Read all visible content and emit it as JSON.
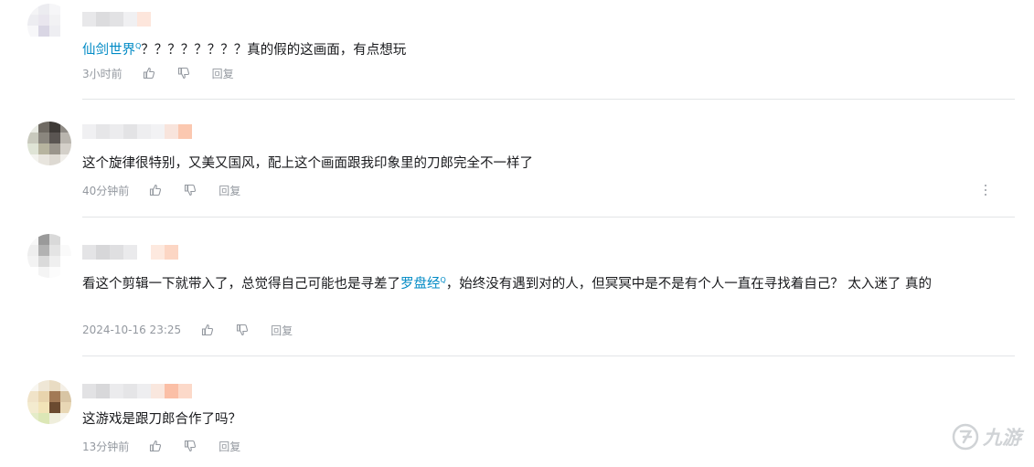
{
  "comments": [
    {
      "link_text": "仙剑世界",
      "link_mark": "Q",
      "text": "？？？？？？？？真的假的这画面，有点想玩",
      "time": "3小时前",
      "reply_label": "回复"
    },
    {
      "text": "这个旋律很特别，又美又国风，配上这个画面跟我印象里的刀郎完全不一样了",
      "time": "40分钟前",
      "reply_label": "回复"
    },
    {
      "text_before": "看这个剪辑一下就带入了，总觉得自己可能也是寻差了",
      "link_text": "罗盘经",
      "link_mark": "Q",
      "text_after": "，始终没有遇到对的人，但冥冥中是不是有个人一直在寻找着自己？ 太入迷了 真的",
      "time": "2024-10-16 23:25",
      "reply_label": "回复"
    },
    {
      "text": "这游戏是跟刀郎合作了吗？",
      "time": "13分钟前",
      "reply_label": "回复"
    }
  ],
  "watermark": "九游",
  "icons": {
    "like": "thumbs-up-icon",
    "dislike": "thumbs-down-icon",
    "more": "more-vertical-icon"
  },
  "colors": {
    "link": "#008ac5",
    "meta_text": "#9499a0",
    "divider": "#e3e5e7"
  }
}
